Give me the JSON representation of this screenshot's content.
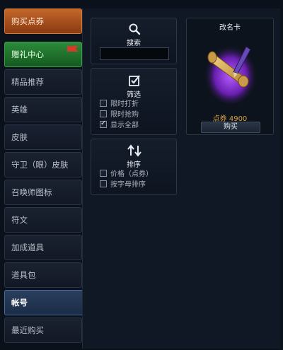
{
  "sidebar": {
    "items": [
      {
        "label": "购买点券"
      },
      {
        "label": "赠礼中心"
      },
      {
        "label": "精品推荐"
      },
      {
        "label": "英雄"
      },
      {
        "label": "皮肤"
      },
      {
        "label": "守卫（眼）皮肤"
      },
      {
        "label": "召唤师图标"
      },
      {
        "label": "符文"
      },
      {
        "label": "加成道具"
      },
      {
        "label": "道具包"
      },
      {
        "label": "帐号"
      },
      {
        "label": "最近购买"
      }
    ],
    "active_index": 10
  },
  "search": {
    "label": "搜索",
    "value": "",
    "icon": "search-icon"
  },
  "filter": {
    "label": "筛选",
    "icon": "checkbox-icon",
    "options": [
      {
        "label": "限时打折",
        "checked": false
      },
      {
        "label": "限时抢购",
        "checked": false
      },
      {
        "label": "显示全部",
        "checked": true
      }
    ]
  },
  "sort": {
    "label": "排序",
    "icon": "sort-arrows-icon",
    "options": [
      {
        "label": "价格（点券）",
        "checked": false
      },
      {
        "label": "按字母排序",
        "checked": false
      }
    ]
  },
  "product": {
    "title": "改名卡",
    "price": "点券 4900",
    "buy_label": "购买",
    "image": "name-change-scroll-image"
  },
  "colors": {
    "accent_orange": "#c4672a",
    "accent_green": "#2c8a3a",
    "price_gold": "#d8a13a",
    "active_blue": "#2a3f5e"
  }
}
